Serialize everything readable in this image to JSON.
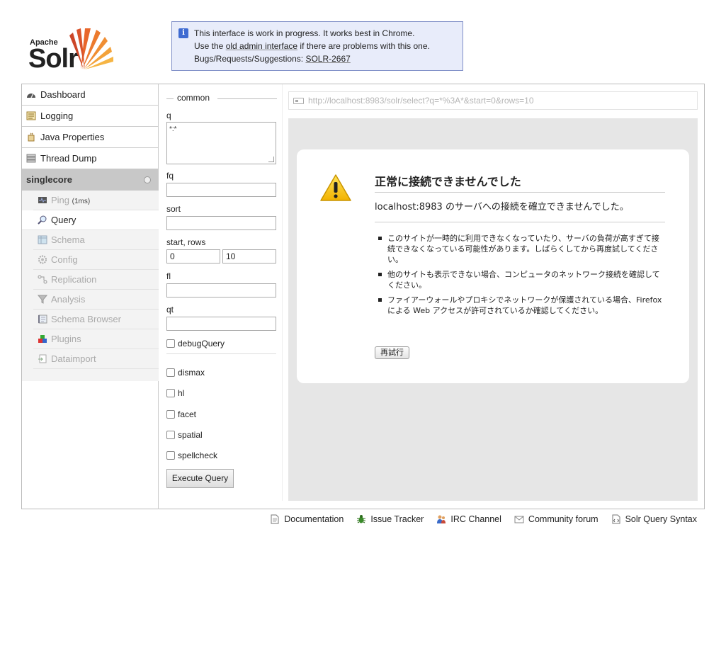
{
  "header": {
    "logo_small": "Apache",
    "logo_big": "Solr",
    "notice": {
      "line1": "This interface is work in progress. It works best in Chrome.",
      "line2_prefix": "Use the ",
      "line2_link": "old admin interface",
      "line2_suffix": " if there are problems with this one.",
      "line3_prefix": "Bugs/Requests/Suggestions: ",
      "line3_link": "SOLR-2667"
    }
  },
  "sidebar": {
    "items": [
      {
        "label": "Dashboard",
        "icon": "dashboard-icon"
      },
      {
        "label": "Logging",
        "icon": "logging-icon"
      },
      {
        "label": "Java Properties",
        "icon": "java-icon"
      },
      {
        "label": "Thread Dump",
        "icon": "thread-dump-icon"
      }
    ],
    "core": {
      "name": "singlecore",
      "items": [
        {
          "label": "Ping",
          "extra": "(1ms)"
        },
        {
          "label": "Query"
        },
        {
          "label": "Schema"
        },
        {
          "label": "Config"
        },
        {
          "label": "Replication"
        },
        {
          "label": "Analysis"
        },
        {
          "label": "Schema Browser"
        },
        {
          "label": "Plugins"
        },
        {
          "label": "Dataimport"
        }
      ]
    }
  },
  "form": {
    "legend": "common",
    "q_label": "q",
    "q_value": "*:*",
    "fq_label": "fq",
    "sort_label": "sort",
    "start_rows_label": "start, rows",
    "start_value": "0",
    "rows_value": "10",
    "fl_label": "fl",
    "qt_label": "qt",
    "debug_label": "debugQuery",
    "checks": [
      "dismax",
      "hl",
      "facet",
      "spatial",
      "spellcheck"
    ],
    "execute_label": "Execute Query"
  },
  "result": {
    "url": "http://localhost:8983/solr/select?q=*%3A*&start=0&rows=10",
    "error": {
      "title": "正常に接続できませんでした",
      "desc": "localhost:8983 のサーバへの接続を確立できませんでした。",
      "bullets": [
        "このサイトが一時的に利用できなくなっていたり、サーバの負荷が高すぎて接続できなくなっている可能性があります。しばらくしてから再度試してください。",
        "他のサイトも表示できない場合、コンピュータのネットワーク接続を確認してください。",
        "ファイアーウォールやプロキシでネットワークが保護されている場合、Firefox による Web アクセスが許可されているか確認してください。"
      ],
      "retry": "再試行"
    }
  },
  "footer": {
    "links": [
      "Documentation",
      "Issue Tracker",
      "IRC Channel",
      "Community forum",
      "Solr Query Syntax"
    ]
  }
}
